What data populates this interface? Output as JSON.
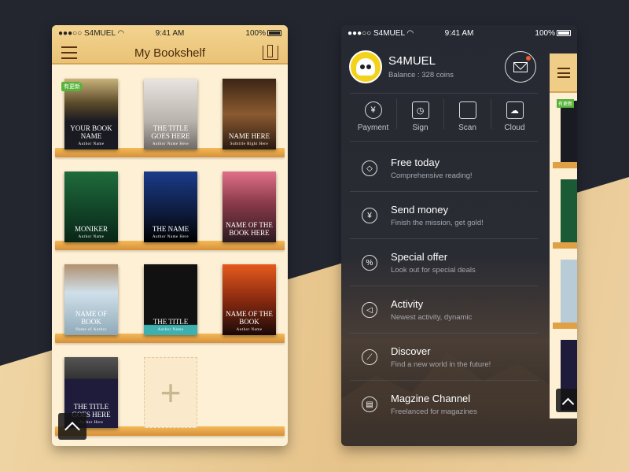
{
  "status": {
    "carrier": "S4MUEL",
    "time": "9:41 AM",
    "battery": "100%"
  },
  "bookshelf": {
    "title": "My Bookshelf",
    "update_badge": "有更新",
    "books": [
      {
        "title": "Your Book Name",
        "author": "Author Name",
        "bg": "linear-gradient(180deg,#c9b27a 0%,#5a4a2a 35%,#1a1a22 60%)"
      },
      {
        "title": "The Title Goes Here",
        "author": "Author Name Here",
        "bg": "linear-gradient(180deg,#e8e4df 0%,#b9b3ad 60%,#6f6a66 100%)"
      },
      {
        "title": "Name Here",
        "author": "Subtitle Right Here",
        "bg": "linear-gradient(180deg,#3a2515,#8a5a30 50%,#2a1a10)"
      },
      {
        "title": "Moniker",
        "author": "Author Name",
        "bg": "linear-gradient(180deg,#1f6b3c,#0e3a22 70%,#0a2416)"
      },
      {
        "title": "The Name",
        "author": "Author Name Here",
        "bg": "linear-gradient(180deg,#1b3c8a,#0d1a3a 60%,#000 100%)"
      },
      {
        "title": "Name of the Book Here",
        "author": "",
        "bg": "linear-gradient(180deg,#e0708a,#8a3a4a 45%,#2b1a20)"
      },
      {
        "title": "Name of Book",
        "author": "Name of Author",
        "bg": "linear-gradient(180deg,#b09070,#cfe0ea 40%,#8fa9b8)"
      },
      {
        "title": "The Title",
        "author": "Author Name",
        "bg": "linear-gradient(180deg,#111 0%,#111 85%,#3db1b0 86%)"
      },
      {
        "title": "Name of The Book",
        "author": "Author Name",
        "bg": "linear-gradient(180deg,#e65a1e,#8a2a10 50%,#1a0a08)"
      },
      {
        "title": "The Title Goes Here",
        "author": "Author Here",
        "bg": "linear-gradient(180deg,#555 0%,#333 30%,#1e1c3a 31%)"
      }
    ]
  },
  "menu": {
    "username": "S4MUEL",
    "balance": "Balance : 328 coins",
    "quick": [
      {
        "label": "Payment",
        "icon": "yen-circle-icon",
        "glyph": "¥"
      },
      {
        "label": "Sign",
        "icon": "calendar-clock-icon",
        "glyph": "◷"
      },
      {
        "label": "Scan",
        "icon": "scan-frame-icon",
        "glyph": ""
      },
      {
        "label": "Cloud",
        "icon": "cloud-icon",
        "glyph": "☁"
      }
    ],
    "items": [
      {
        "title": "Free today",
        "subtitle": "Comprehensive reading!",
        "icon": "tag-icon",
        "glyph": "◇"
      },
      {
        "title": "Send money",
        "subtitle": "Finish the mission, get gold!",
        "icon": "money-bag-icon",
        "glyph": "¥"
      },
      {
        "title": "Special offer",
        "subtitle": "Look out for special deals",
        "icon": "percent-badge-icon",
        "glyph": "%"
      },
      {
        "title": "Activity",
        "subtitle": "Newest activity, dynamic",
        "icon": "megaphone-icon",
        "glyph": "◁"
      },
      {
        "title": "Discover",
        "subtitle": "Find a new world in the future!",
        "icon": "compass-icon",
        "glyph": "⟋"
      },
      {
        "title": "Magzine Channel",
        "subtitle": "Freelanced for magazines",
        "icon": "newspaper-icon",
        "glyph": "▤"
      }
    ]
  },
  "colors": {
    "background": "#23262f",
    "wood": "#e6c38a",
    "badge": "#58b33a",
    "notification": "#f05a28"
  }
}
